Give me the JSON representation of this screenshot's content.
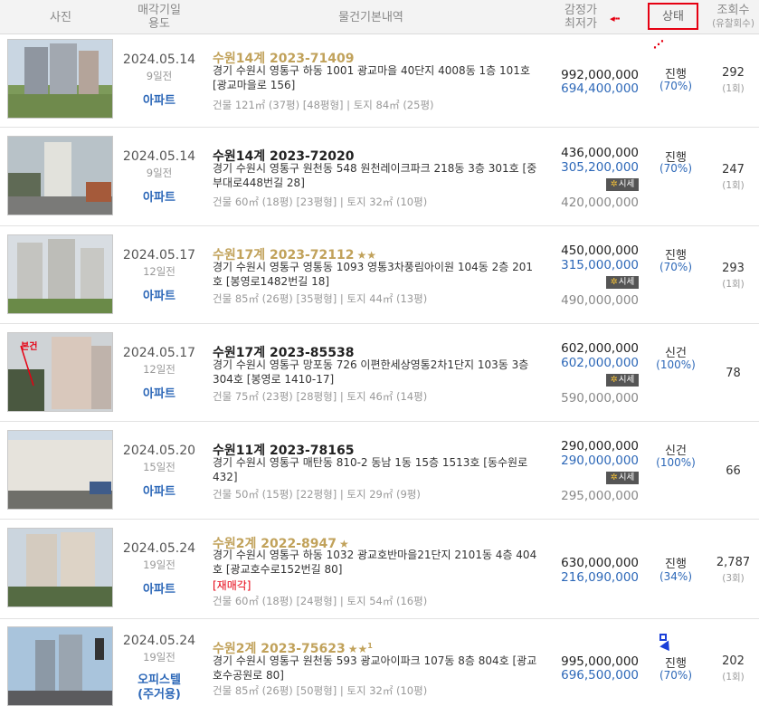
{
  "header": {
    "photo": "사진",
    "date_line1": "매각기일",
    "date_line2": "용도",
    "basic": "물건기본내역",
    "price_line1": "감정가",
    "price_line2": "최저가",
    "status": "상태",
    "views_line1": "조회수",
    "views_line2": "(유찰회수)"
  },
  "market_badge": "시세",
  "rows": [
    {
      "date": "2024.05.14",
      "days_ago": "9일전",
      "usage": "아파트",
      "case": "수원14계 2023-71409",
      "stars": "",
      "address": "경기 수원시 영통구 하동 1001 광교마을 40단지 4008동 1층 101호 [광교마을로 156]",
      "resale": "",
      "area": "건물 121㎡ (37평) [48평형]  |  토지 84㎡ (25평)",
      "appraisal": "992,000,000",
      "min_bid": "694,400,000",
      "market": "",
      "status": "진행",
      "pct": "(70%)",
      "views": "292",
      "fail_count": "(1회)"
    },
    {
      "date": "2024.05.14",
      "days_ago": "9일전",
      "usage": "아파트",
      "case": "수원14계 2023-72020",
      "stars": "",
      "address": "경기 수원시 영통구 원천동 548 원천레이크파크 218동 3층 301호 [중부대로448번길 28]",
      "resale": "",
      "area": "건물 60㎡ (18평) [23평형]  |  토지 32㎡ (10평)",
      "appraisal": "436,000,000",
      "min_bid": "305,200,000",
      "market": "420,000,000",
      "status": "진행",
      "pct": "(70%)",
      "views": "247",
      "fail_count": "(1회)"
    },
    {
      "date": "2024.05.17",
      "days_ago": "12일전",
      "usage": "아파트",
      "case": "수원17계 2023-72112",
      "stars": "★★",
      "address": "경기 수원시 영통구 영통동 1093 영통3차풍림아이원 104동 2층 201호 [봉영로1482번길 18]",
      "resale": "",
      "area": "건물 85㎡ (26평) [35평형]  |  토지 44㎡ (13평)",
      "appraisal": "450,000,000",
      "min_bid": "315,000,000",
      "market": "490,000,000",
      "status": "진행",
      "pct": "(70%)",
      "views": "293",
      "fail_count": "(1회)"
    },
    {
      "date": "2024.05.17",
      "days_ago": "12일전",
      "usage": "아파트",
      "case": "수원17계 2023-85538",
      "stars": "",
      "address": "경기 수원시 영통구 망포동 726 이편한세상영통2차1단지 103동 3층 304호 [봉영로 1410-17]",
      "resale": "",
      "area": "건물 75㎡ (23평) [28평형]  |  토지 46㎡ (14평)",
      "appraisal": "602,000,000",
      "min_bid": "602,000,000",
      "market": "590,000,000",
      "status": "신건",
      "pct": "(100%)",
      "views": "78",
      "fail_count": "",
      "photo_label": "본건"
    },
    {
      "date": "2024.05.20",
      "days_ago": "15일전",
      "usage": "아파트",
      "case": "수원11계 2023-78165",
      "stars": "",
      "address": "경기 수원시 영통구 매탄동 810-2 동남 1동 15층 1513호 [동수원로 432]",
      "resale": "",
      "area": "건물 50㎡ (15평) [22평형]  |  토지 29㎡ (9평)",
      "appraisal": "290,000,000",
      "min_bid": "290,000,000",
      "market": "295,000,000",
      "status": "신건",
      "pct": "(100%)",
      "views": "66",
      "fail_count": ""
    },
    {
      "date": "2024.05.24",
      "days_ago": "19일전",
      "usage": "아파트",
      "case": "수원2계 2022-8947",
      "stars": "★",
      "address": "경기 수원시 영통구 하동 1032 광교호반마을21단지 2101동 4층 404호 [광교호수로152번길 80]",
      "resale": "[재매각]",
      "area": "건물 60㎡ (18평) [24평형]  |  토지 54㎡ (16평)",
      "appraisal": "630,000,000",
      "min_bid": "216,090,000",
      "market": "",
      "status": "진행",
      "pct": "(34%)",
      "views": "2,787",
      "fail_count": "(3회)"
    },
    {
      "date": "2024.05.24",
      "days_ago": "19일전",
      "usage": "오피스텔\n(주거용)",
      "case": "수원2계 2023-75623",
      "stars": "★★",
      "stars_sup": "1",
      "address": "경기 수원시 영통구 원천동 593 광교아이파크 107동 8층 804호 [광교호수공원로 80]",
      "resale": "",
      "area": "건물 85㎡ (26평) [50평형]  |  토지 32㎡ (10평)",
      "appraisal": "995,000,000",
      "min_bid": "696,500,000",
      "market": "",
      "status": "진행",
      "pct": "(70%)",
      "views": "202",
      "fail_count": "(1회)"
    }
  ]
}
